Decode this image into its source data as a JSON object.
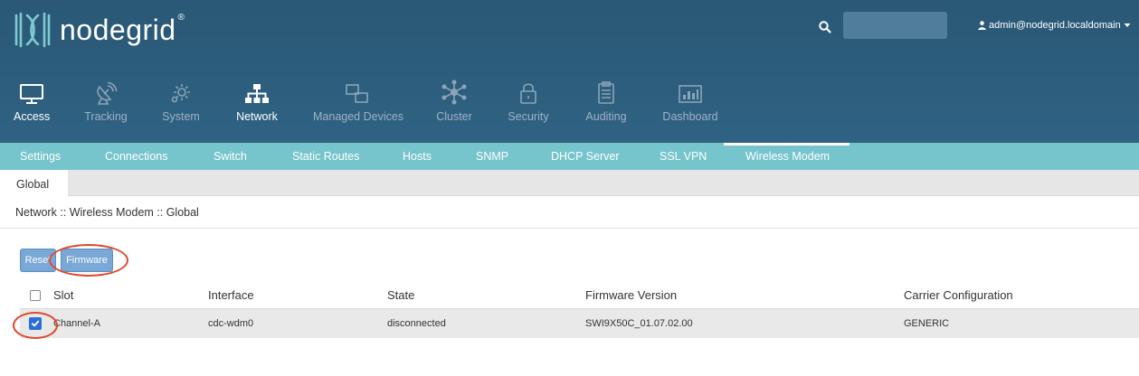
{
  "app": {
    "brand": "nodegrid",
    "brand_mark": "®",
    "search": {
      "value": "",
      "placeholder": ""
    },
    "user": "admin@nodegrid.localdomain"
  },
  "main_nav": [
    {
      "label": "Access",
      "icon": "monitor-icon",
      "state": "enabled"
    },
    {
      "label": "Tracking",
      "icon": "satellite-dish-icon",
      "state": "disabled"
    },
    {
      "label": "System",
      "icon": "gear-icon",
      "state": "disabled"
    },
    {
      "label": "Network",
      "icon": "network-icon",
      "state": "active"
    },
    {
      "label": "Managed Devices",
      "icon": "devices-icon",
      "state": "disabled"
    },
    {
      "label": "Cluster",
      "icon": "cluster-icon",
      "state": "disabled"
    },
    {
      "label": "Security",
      "icon": "lock-icon",
      "state": "disabled"
    },
    {
      "label": "Auditing",
      "icon": "clipboard-icon",
      "state": "disabled"
    },
    {
      "label": "Dashboard",
      "icon": "dashboard-icon",
      "state": "disabled"
    }
  ],
  "sub_nav": [
    {
      "label": "Settings"
    },
    {
      "label": "Connections"
    },
    {
      "label": "Switch"
    },
    {
      "label": "Static Routes"
    },
    {
      "label": "Hosts"
    },
    {
      "label": "SNMP"
    },
    {
      "label": "DHCP Server"
    },
    {
      "label": "SSL VPN"
    },
    {
      "label": "Wireless Modem",
      "active": true
    }
  ],
  "tabs": [
    {
      "label": "Global",
      "active": true
    }
  ],
  "breadcrumb": "Network :: Wireless Modem :: Global",
  "actions": {
    "reset": "Reset",
    "firmware": "Firmware"
  },
  "table": {
    "columns": [
      "Slot",
      "Interface",
      "State",
      "Firmware Version",
      "Carrier Configuration"
    ],
    "rows": [
      {
        "slot": "Channel-A",
        "interface": "cdc-wdm0",
        "state": "disconnected",
        "firmware": "SWI9X50C_01.07.02.00",
        "carrier": "GENERIC",
        "selected": true
      }
    ]
  },
  "colors": {
    "header_bg": "#2a5876",
    "subnav_bg": "#76c4cc",
    "button_bg": "#7aa8d6",
    "annotation_ring": "#e0482b",
    "checkbox_checked": "#2b6fd6"
  }
}
